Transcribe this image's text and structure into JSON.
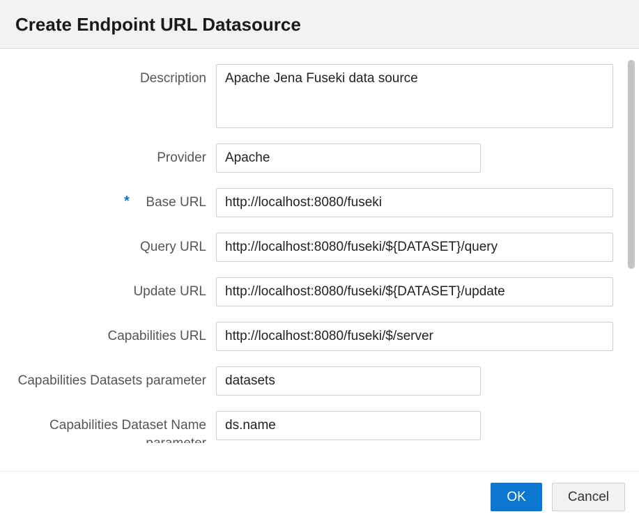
{
  "dialog": {
    "title": "Create Endpoint URL Datasource",
    "required_marker": "*"
  },
  "form": {
    "description": {
      "label": "Description",
      "value": "Apache Jena Fuseki data source"
    },
    "provider": {
      "label": "Provider",
      "value": "Apache"
    },
    "base_url": {
      "label": "Base URL",
      "required": true,
      "value": "http://localhost:8080/fuseki"
    },
    "query_url": {
      "label": "Query URL",
      "value": "http://localhost:8080/fuseki/${DATASET}/query"
    },
    "update_url": {
      "label": "Update URL",
      "value": "http://localhost:8080/fuseki/${DATASET}/update"
    },
    "capabilities_url": {
      "label": "Capabilities URL",
      "value": "http://localhost:8080/fuseki/$/server"
    },
    "cap_datasets_param": {
      "label": "Capabilities Datasets parameter",
      "value": "datasets"
    },
    "cap_dataset_name_param": {
      "label": "Capabilities Dataset Name parameter",
      "value": "ds.name"
    }
  },
  "buttons": {
    "ok": "OK",
    "cancel": "Cancel"
  }
}
